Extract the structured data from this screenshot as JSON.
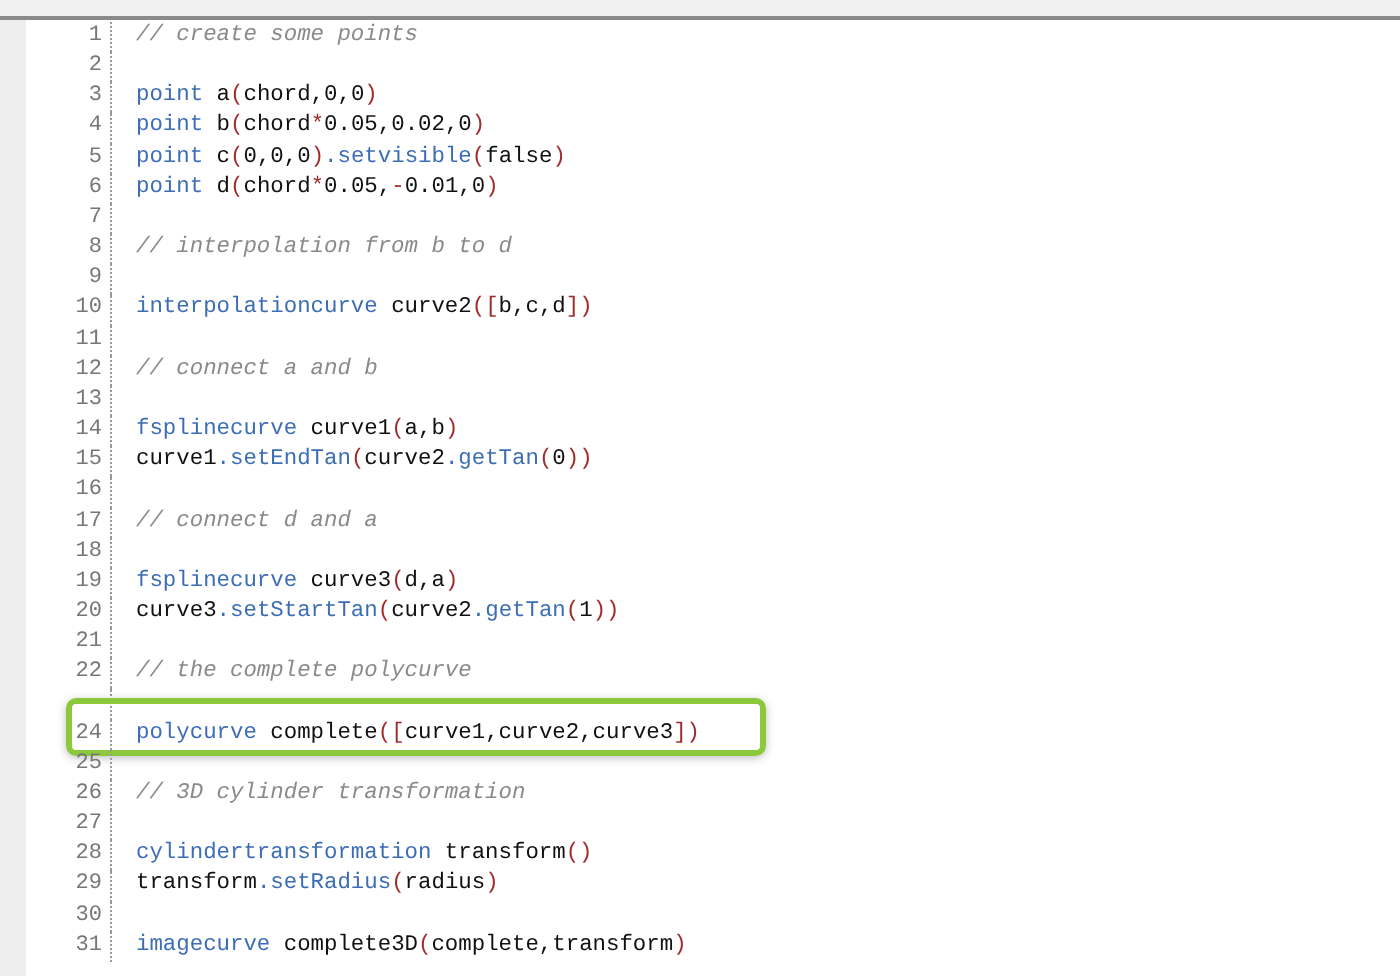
{
  "editor": {
    "lines": [
      {
        "number": "1",
        "highlighted": false,
        "tokens": [
          {
            "kind": "comment",
            "text": "// create some points"
          }
        ]
      },
      {
        "number": "2",
        "highlighted": false
      },
      {
        "number": "3",
        "highlighted": false,
        "tokens": [
          {
            "kind": "keyword",
            "text": "point"
          },
          {
            "kind": "plain",
            "text": " a"
          },
          {
            "kind": "paren",
            "text": "("
          },
          {
            "kind": "plain",
            "text": "chord,0,0"
          },
          {
            "kind": "paren",
            "text": ")"
          }
        ]
      },
      {
        "number": "4",
        "highlighted": false,
        "tokens": [
          {
            "kind": "keyword",
            "text": "point"
          },
          {
            "kind": "plain",
            "text": " b"
          },
          {
            "kind": "paren",
            "text": "("
          },
          {
            "kind": "plain",
            "text": "chord"
          },
          {
            "kind": "paren",
            "text": "*"
          },
          {
            "kind": "plain",
            "text": "0.05,0.02,0"
          },
          {
            "kind": "paren",
            "text": ")"
          }
        ]
      },
      {
        "number": "5",
        "highlighted": false,
        "tokens": [
          {
            "kind": "keyword",
            "text": "point"
          },
          {
            "kind": "plain",
            "text": " c"
          },
          {
            "kind": "paren",
            "text": "("
          },
          {
            "kind": "plain",
            "text": "0,0,0"
          },
          {
            "kind": "paren",
            "text": ")"
          },
          {
            "kind": "keyword",
            "text": ".setvisible"
          },
          {
            "kind": "paren",
            "text": "("
          },
          {
            "kind": "plain",
            "text": "false"
          },
          {
            "kind": "paren",
            "text": ")"
          }
        ]
      },
      {
        "number": "6",
        "highlighted": false,
        "tokens": [
          {
            "kind": "keyword",
            "text": "point"
          },
          {
            "kind": "plain",
            "text": " d"
          },
          {
            "kind": "paren",
            "text": "("
          },
          {
            "kind": "plain",
            "text": "chord"
          },
          {
            "kind": "paren",
            "text": "*"
          },
          {
            "kind": "plain",
            "text": "0.05,"
          },
          {
            "kind": "paren",
            "text": "-"
          },
          {
            "kind": "plain",
            "text": "0.01,0"
          },
          {
            "kind": "paren",
            "text": ")"
          }
        ]
      },
      {
        "number": "7",
        "highlighted": false
      },
      {
        "number": "8",
        "highlighted": false,
        "tokens": [
          {
            "kind": "comment",
            "text": "// interpolation from b to d"
          }
        ]
      },
      {
        "number": "9",
        "highlighted": false
      },
      {
        "number": "10",
        "highlighted": false,
        "tokens": [
          {
            "kind": "keyword",
            "text": "interpolationcurve"
          },
          {
            "kind": "plain",
            "text": " curve2"
          },
          {
            "kind": "paren",
            "text": "(["
          },
          {
            "kind": "plain",
            "text": "b,c,d"
          },
          {
            "kind": "paren",
            "text": "])"
          }
        ]
      },
      {
        "number": "11",
        "highlighted": false
      },
      {
        "number": "12",
        "highlighted": false,
        "tokens": [
          {
            "kind": "comment",
            "text": "// connect a and b"
          }
        ]
      },
      {
        "number": "13",
        "highlighted": false
      },
      {
        "number": "14",
        "highlighted": false,
        "tokens": [
          {
            "kind": "keyword",
            "text": "fsplinecurve"
          },
          {
            "kind": "plain",
            "text": " curve1"
          },
          {
            "kind": "paren",
            "text": "("
          },
          {
            "kind": "plain",
            "text": "a,b"
          },
          {
            "kind": "paren",
            "text": ")"
          }
        ]
      },
      {
        "number": "15",
        "highlighted": false,
        "tokens": [
          {
            "kind": "plain",
            "text": "curve1"
          },
          {
            "kind": "keyword",
            "text": ".setEndTan"
          },
          {
            "kind": "paren",
            "text": "("
          },
          {
            "kind": "plain",
            "text": "curve2"
          },
          {
            "kind": "keyword",
            "text": ".getTan"
          },
          {
            "kind": "paren",
            "text": "("
          },
          {
            "kind": "plain",
            "text": "0"
          },
          {
            "kind": "paren",
            "text": "))"
          }
        ]
      },
      {
        "number": "16",
        "highlighted": false
      },
      {
        "number": "17",
        "highlighted": false,
        "tokens": [
          {
            "kind": "comment",
            "text": "// connect d and a"
          }
        ]
      },
      {
        "number": "18",
        "highlighted": false
      },
      {
        "number": "19",
        "highlighted": false,
        "tokens": [
          {
            "kind": "keyword",
            "text": "fsplinecurve"
          },
          {
            "kind": "plain",
            "text": " curve3"
          },
          {
            "kind": "paren",
            "text": "("
          },
          {
            "kind": "plain",
            "text": "d,a"
          },
          {
            "kind": "paren",
            "text": ")"
          }
        ]
      },
      {
        "number": "20",
        "highlighted": false,
        "tokens": [
          {
            "kind": "plain",
            "text": "curve3"
          },
          {
            "kind": "keyword",
            "text": ".setStartTan"
          },
          {
            "kind": "paren",
            "text": "("
          },
          {
            "kind": "plain",
            "text": "curve2"
          },
          {
            "kind": "keyword",
            "text": ".getTan"
          },
          {
            "kind": "paren",
            "text": "("
          },
          {
            "kind": "plain",
            "text": "1"
          },
          {
            "kind": "paren",
            "text": "))"
          }
        ]
      },
      {
        "number": "21",
        "highlighted": false
      },
      {
        "number": "22",
        "highlighted": false,
        "tokens": [
          {
            "kind": "comment",
            "text": "// the complete polycurve"
          }
        ]
      },
      {
        "highlighted": false
      },
      {
        "number": "24",
        "highlighted": true,
        "tokens": [
          {
            "kind": "keyword",
            "text": "polycurve"
          },
          {
            "kind": "plain",
            "text": " complete"
          },
          {
            "kind": "paren",
            "text": "(["
          },
          {
            "kind": "plain",
            "text": "curve1,curve2,curve3"
          },
          {
            "kind": "paren",
            "text": "])"
          }
        ]
      },
      {
        "number": "25",
        "highlighted": false
      },
      {
        "number": "26",
        "highlighted": false,
        "tokens": [
          {
            "kind": "comment",
            "text": "// 3D cylinder transformation"
          }
        ]
      },
      {
        "number": "27",
        "highlighted": false
      },
      {
        "number": "28",
        "highlighted": false,
        "tokens": [
          {
            "kind": "keyword",
            "text": "cylindertransformation"
          },
          {
            "kind": "plain",
            "text": " transform"
          },
          {
            "kind": "paren",
            "text": "()"
          }
        ]
      },
      {
        "number": "29",
        "highlighted": false,
        "tokens": [
          {
            "kind": "plain",
            "text": "transform"
          },
          {
            "kind": "keyword",
            "text": ".setRadius"
          },
          {
            "kind": "paren",
            "text": "("
          },
          {
            "kind": "plain",
            "text": "radius"
          },
          {
            "kind": "paren",
            "text": ")"
          }
        ]
      },
      {
        "number": "30",
        "highlighted": false
      },
      {
        "number": "31",
        "highlighted": false,
        "tokens": [
          {
            "kind": "keyword",
            "text": "imagecurve"
          },
          {
            "kind": "plain",
            "text": " complete3D"
          },
          {
            "kind": "paren",
            "text": "("
          },
          {
            "kind": "plain",
            "text": "complete,transform"
          },
          {
            "kind": "paren",
            "text": ")"
          }
        ]
      }
    ]
  }
}
